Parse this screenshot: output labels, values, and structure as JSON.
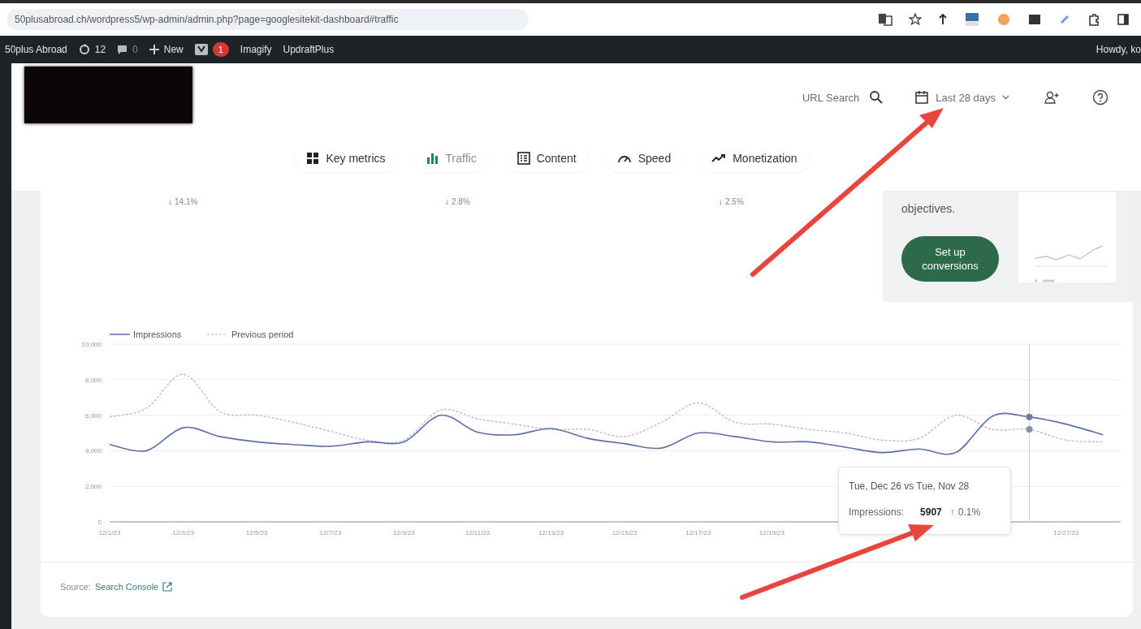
{
  "browser": {
    "url": "50plusabroad.ch/wordpress5/wp-admin/admin.php?page=googlesitekit-dashboard#traffic"
  },
  "admin_bar": {
    "site": "50plus Abroad",
    "updates": "12",
    "comments": "0",
    "new": "New",
    "seo_badge": "1",
    "items": [
      "Imagify",
      "UpdraftPlus"
    ],
    "greeting": "Howdy, ko"
  },
  "header": {
    "url_search": "URL Search",
    "date_range": "Last 28 days"
  },
  "nav": [
    {
      "label": "Key metrics",
      "kind": "grid",
      "selected": false
    },
    {
      "label": "Traffic",
      "kind": "bars",
      "selected": true
    },
    {
      "label": "Content",
      "kind": "list",
      "selected": false
    },
    {
      "label": "Speed",
      "kind": "gauge",
      "selected": false
    },
    {
      "label": "Monetization",
      "kind": "trend",
      "selected": false
    }
  ],
  "metric_changes": [
    {
      "arrow": "↓",
      "text": "14.1%"
    },
    {
      "arrow": "↓",
      "text": "2.8%"
    },
    {
      "arrow": "↓",
      "text": "2.5%"
    }
  ],
  "promo": {
    "text": "objectives.",
    "button": "Set up conversions"
  },
  "chart": {
    "chart_data": {
      "type": "line",
      "categories": [
        "12/1/23",
        null,
        "12/3/23",
        null,
        "12/5/23",
        null,
        "12/7/23",
        null,
        "12/9/23",
        null,
        "12/11/23",
        null,
        "12/13/23",
        null,
        "12/15/23",
        null,
        "12/17/23",
        null,
        "12/19/23",
        null,
        null,
        null,
        null,
        null,
        null,
        null,
        "12/27/23",
        null
      ],
      "grid": true,
      "legend": "top-left",
      "series": [
        {
          "name": "Impressions",
          "color": "#5c6fa8",
          "line_style": "solid",
          "values": [
            4350,
            4000,
            5300,
            4800,
            4500,
            4350,
            4250,
            4500,
            4500,
            6000,
            5050,
            4900,
            5250,
            4700,
            4400,
            4150,
            5000,
            4800,
            4500,
            4500,
            4200,
            3900,
            4100,
            3900,
            5950,
            5900,
            5500,
            4900
          ]
        },
        {
          "name": "Previous period",
          "color": "#b4b8d8",
          "line_style": "dashed",
          "values": [
            5900,
            6400,
            8300,
            6200,
            6000,
            5600,
            5100,
            4600,
            4600,
            6300,
            5800,
            5500,
            5200,
            5200,
            4800,
            5600,
            6700,
            5600,
            5500,
            5200,
            5000,
            4600,
            4700,
            6000,
            5200,
            5200,
            4600,
            4500
          ]
        }
      ],
      "ylim": [
        0,
        10000
      ],
      "yticks": [
        {
          "value": 0,
          "label": "0"
        },
        {
          "value": 2000,
          "label": "2,000"
        },
        {
          "value": 4000,
          "label": "4,000"
        },
        {
          "value": 6000,
          "label": "6,000"
        },
        {
          "value": 8000,
          "label": "8,000"
        },
        {
          "value": 10000,
          "label": "10,000"
        }
      ]
    },
    "tooltip": {
      "title": "Tue, Dec 26 vs Tue, Nov 28",
      "metric": "Impressions:",
      "value": "5907",
      "arrow": "↑",
      "change": "0.1%"
    }
  },
  "source": {
    "label": "Source:",
    "link": "Search Console"
  }
}
